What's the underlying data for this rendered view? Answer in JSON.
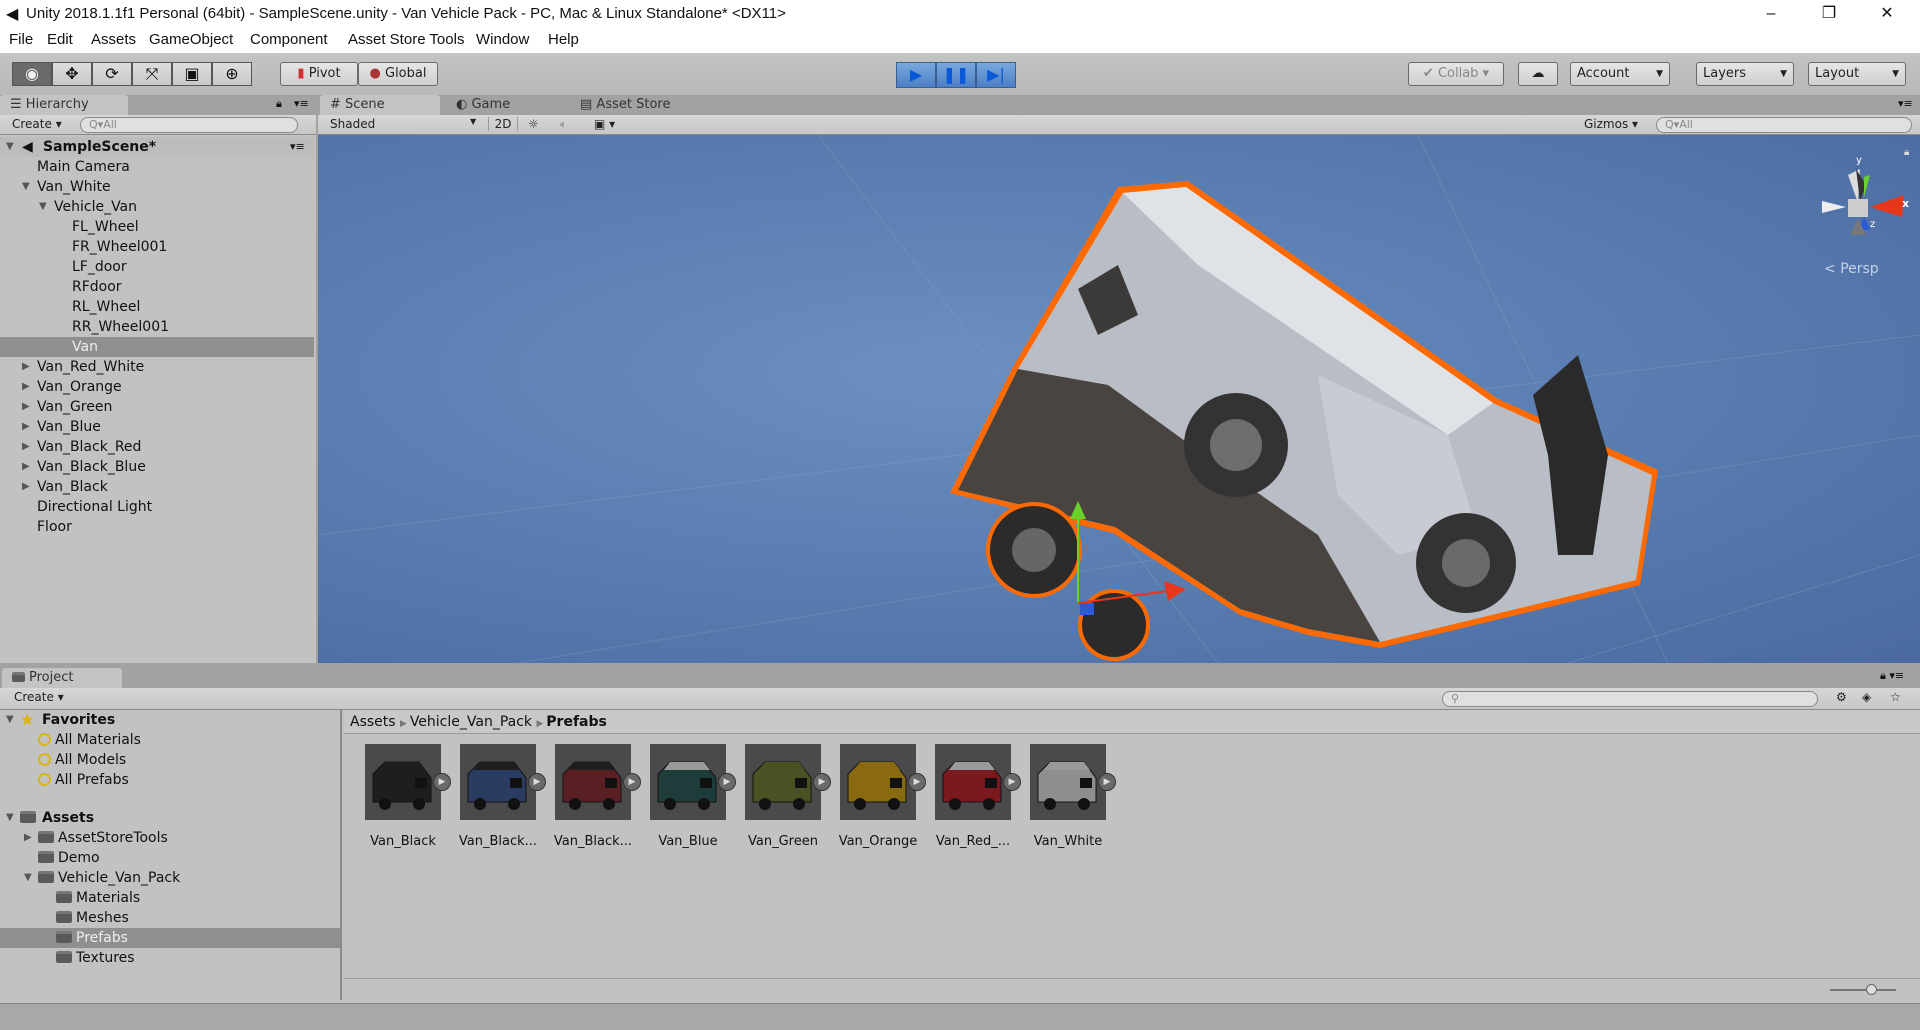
{
  "window": {
    "title": "Unity 2018.1.1f1 Personal (64bit) - SampleScene.unity - Van Vehicle Pack - PC, Mac & Linux Standalone* <DX11>"
  },
  "menu": [
    "File",
    "Edit",
    "Assets",
    "GameObject",
    "Component",
    "Asset Store Tools",
    "Window",
    "Help"
  ],
  "toolbar": {
    "pivot": "Pivot",
    "global": "Global",
    "collab": "Collab",
    "account": "Account",
    "layers": "Layers",
    "layout": "Layout"
  },
  "hierarchy": {
    "tab": "Hierarchy",
    "create": "Create",
    "search_placeholder": "All",
    "scene": "SampleScene*",
    "items": [
      {
        "label": "Main Camera",
        "depth": 1,
        "expand": ""
      },
      {
        "label": "Van_White",
        "depth": 1,
        "expand": "open"
      },
      {
        "label": "Vehicle_Van",
        "depth": 2,
        "expand": "open"
      },
      {
        "label": "FL_Wheel",
        "depth": 3,
        "expand": ""
      },
      {
        "label": "FR_Wheel001",
        "depth": 3,
        "expand": ""
      },
      {
        "label": "LF_door",
        "depth": 3,
        "expand": ""
      },
      {
        "label": "RFdoor",
        "depth": 3,
        "expand": ""
      },
      {
        "label": "RL_Wheel",
        "depth": 3,
        "expand": ""
      },
      {
        "label": "RR_Wheel001",
        "depth": 3,
        "expand": ""
      },
      {
        "label": "Van",
        "depth": 3,
        "expand": "",
        "selected": true
      },
      {
        "label": "Van_Red_White",
        "depth": 1,
        "expand": "closed"
      },
      {
        "label": "Van_Orange",
        "depth": 1,
        "expand": "closed"
      },
      {
        "label": "Van_Green",
        "depth": 1,
        "expand": "closed"
      },
      {
        "label": "Van_Blue",
        "depth": 1,
        "expand": "closed"
      },
      {
        "label": "Van_Black_Red",
        "depth": 1,
        "expand": "closed"
      },
      {
        "label": "Van_Black_Blue",
        "depth": 1,
        "expand": "closed"
      },
      {
        "label": "Van_Black",
        "depth": 1,
        "expand": "closed"
      },
      {
        "label": "Directional Light",
        "depth": 1,
        "expand": ""
      },
      {
        "label": "Floor",
        "depth": 1,
        "expand": ""
      }
    ]
  },
  "scene": {
    "tabs": [
      "Scene",
      "Game",
      "Asset Store"
    ],
    "shading": "Shaded",
    "mode_2d": "2D",
    "gizmos": "Gizmos",
    "search_placeholder": "All",
    "persp": "Persp",
    "axis_x": "x",
    "axis_y": "y",
    "axis_z": "z"
  },
  "project": {
    "tab": "Project",
    "create": "Create",
    "favorites_label": "Favorites",
    "favorites": [
      "All Materials",
      "All Models",
      "All Prefabs"
    ],
    "assets_label": "Assets",
    "folders": [
      {
        "label": "AssetStoreTools",
        "depth": 1,
        "expand": "closed"
      },
      {
        "label": "Demo",
        "depth": 1,
        "expand": ""
      },
      {
        "label": "Vehicle_Van_Pack",
        "depth": 1,
        "expand": "open"
      },
      {
        "label": "Materials",
        "depth": 2,
        "expand": ""
      },
      {
        "label": "Meshes",
        "depth": 2,
        "expand": ""
      },
      {
        "label": "Prefabs",
        "depth": 2,
        "expand": "",
        "selected": true
      },
      {
        "label": "Textures",
        "depth": 2,
        "expand": ""
      }
    ],
    "breadcrumb": [
      "Assets",
      "Vehicle_Van_Pack",
      "Prefabs"
    ],
    "prefabs": [
      {
        "label": "Van_Black",
        "color": "#1e1e1e",
        "roof": "#1e1e1e"
      },
      {
        "label": "Van_Black...",
        "color": "#2a3c62",
        "roof": "#1e1e1e"
      },
      {
        "label": "Van_Black...",
        "color": "#5a1f22",
        "roof": "#1e1e1e"
      },
      {
        "label": "Van_Blue",
        "color": "#1e3d3a",
        "roof": "#9a9a9a"
      },
      {
        "label": "Van_Green",
        "color": "#4a5224",
        "roof": "#4a5224"
      },
      {
        "label": "Van_Orange",
        "color": "#8a6a10",
        "roof": "#8a6a10"
      },
      {
        "label": "Van_Red_...",
        "color": "#7a1a1e",
        "roof": "#9a9a9a"
      },
      {
        "label": "Van_White",
        "color": "#8e8e8e",
        "roof": "#9a9a9a"
      }
    ]
  },
  "colors": {
    "selection_outline": "#ff6a00",
    "play_accent": "#1a6ee0"
  }
}
